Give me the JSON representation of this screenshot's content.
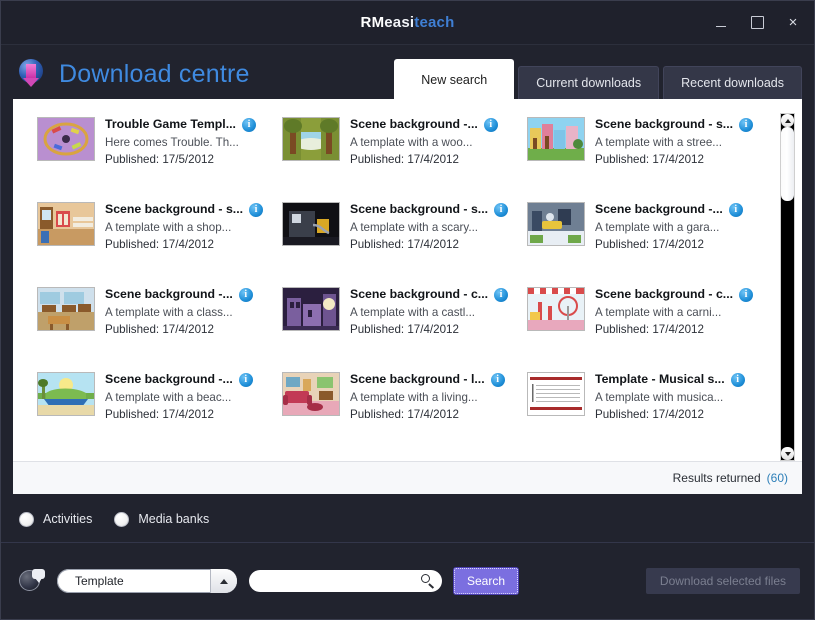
{
  "window": {
    "brand_rm": "RM",
    "brand_easi": "easi",
    "brand_teach": "teach",
    "minimize_label": "Minimize",
    "maximize_label": "Maximize",
    "close_label": "×"
  },
  "header": {
    "title": "Download centre",
    "tabs": [
      {
        "label": "New search",
        "active": true
      },
      {
        "label": "Current downloads",
        "active": false
      },
      {
        "label": "Recent downloads",
        "active": false
      }
    ]
  },
  "results": {
    "footer_label": "Results returned",
    "count": "(60)",
    "items": [
      {
        "title": "Trouble Game Templ...",
        "desc": "Here comes Trouble. Th...",
        "published": "Published: 17/5/2012",
        "thumb": "trouble-game",
        "info": "i"
      },
      {
        "title": "Scene background -...",
        "desc": "A template with a woo...",
        "published": "Published: 17/4/2012",
        "thumb": "woodland",
        "info": "i"
      },
      {
        "title": "Scene background - s...",
        "desc": "A template with a stree...",
        "published": "Published: 17/4/2012",
        "thumb": "street",
        "info": "i"
      },
      {
        "title": "Scene background - s...",
        "desc": "A template with a shop...",
        "published": "Published: 17/4/2012",
        "thumb": "shop",
        "info": "i"
      },
      {
        "title": "Scene background - s...",
        "desc": "A template with a scary...",
        "published": "Published: 17/4/2012",
        "thumb": "scary",
        "info": "i"
      },
      {
        "title": "Scene background -...",
        "desc": "A template with a gara...",
        "published": "Published: 17/4/2012",
        "thumb": "garage",
        "info": "i"
      },
      {
        "title": "Scene background -...",
        "desc": "A template with a class...",
        "published": "Published: 17/4/2012",
        "thumb": "classroom",
        "info": "i"
      },
      {
        "title": "Scene background - c...",
        "desc": "A template with a castl...",
        "published": "Published: 17/4/2012",
        "thumb": "castle",
        "info": "i"
      },
      {
        "title": "Scene background - c...",
        "desc": "A template with a carni...",
        "published": "Published: 17/4/2012",
        "thumb": "carnival",
        "info": "i"
      },
      {
        "title": "Scene background -...",
        "desc": "A template with a beac...",
        "published": "Published: 17/4/2012",
        "thumb": "beach",
        "info": "i"
      },
      {
        "title": "Scene background - l...",
        "desc": "A template with a living...",
        "published": "Published: 17/4/2012",
        "thumb": "living-room",
        "info": "i"
      },
      {
        "title": "Template - Musical s...",
        "desc": "A template with musica...",
        "published": "Published: 17/4/2012",
        "thumb": "musical-score",
        "info": "i"
      }
    ]
  },
  "filters": {
    "options": [
      {
        "label": "Activities",
        "selected": false
      },
      {
        "label": "Media banks",
        "selected": false
      }
    ]
  },
  "toolbar": {
    "category_value": "Template",
    "search_value": "",
    "search_placeholder": "",
    "search_button": "Search",
    "download_button": "Download selected files"
  },
  "colors": {
    "accent_blue": "#3f8ae0",
    "count_blue": "#2d7fb8",
    "search_purple": "#7b6fe0",
    "window_bg": "#21232e"
  }
}
